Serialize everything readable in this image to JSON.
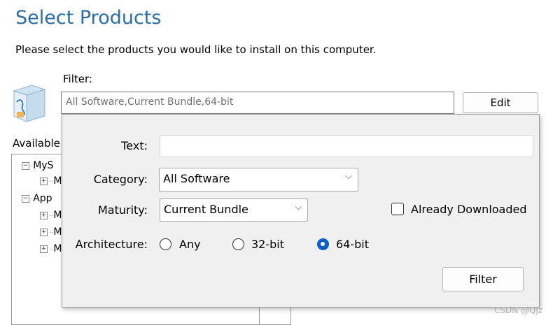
{
  "page": {
    "title": "Select Products",
    "subtitle": "Please select the products you would like to install on this computer."
  },
  "filter": {
    "label": "Filter:",
    "value": "All Software,Current Bundle,64-bit",
    "edit_label": "Edit"
  },
  "available": {
    "label": "Available",
    "tree": [
      {
        "expander": "−",
        "label": "MyS"
      },
      {
        "expander": "+",
        "label": "M"
      },
      {
        "expander": "−",
        "label": "App"
      },
      {
        "expander": "+",
        "label": "M"
      },
      {
        "expander": "+",
        "label": "M"
      },
      {
        "expander": "+",
        "label": "M"
      }
    ]
  },
  "popup": {
    "text_label": "Text:",
    "text_value": "",
    "category_label": "Category:",
    "category_value": "All Software",
    "maturity_label": "Maturity:",
    "maturity_value": "Current Bundle",
    "already_downloaded_label": "Already Downloaded",
    "already_downloaded_checked": false,
    "architecture_label": "Architecture:",
    "architecture_options": [
      "Any",
      "32-bit",
      "64-bit"
    ],
    "architecture_selected": "64-bit",
    "filter_button_label": "Filter"
  },
  "watermark": "CSDN @Qjz",
  "colors": {
    "title": "#2b6ea6",
    "radio_selected": "#0a5fc9"
  },
  "icons": {
    "product": "mysql-installer-box-icon",
    "dropdown": "chevron-down-icon"
  }
}
